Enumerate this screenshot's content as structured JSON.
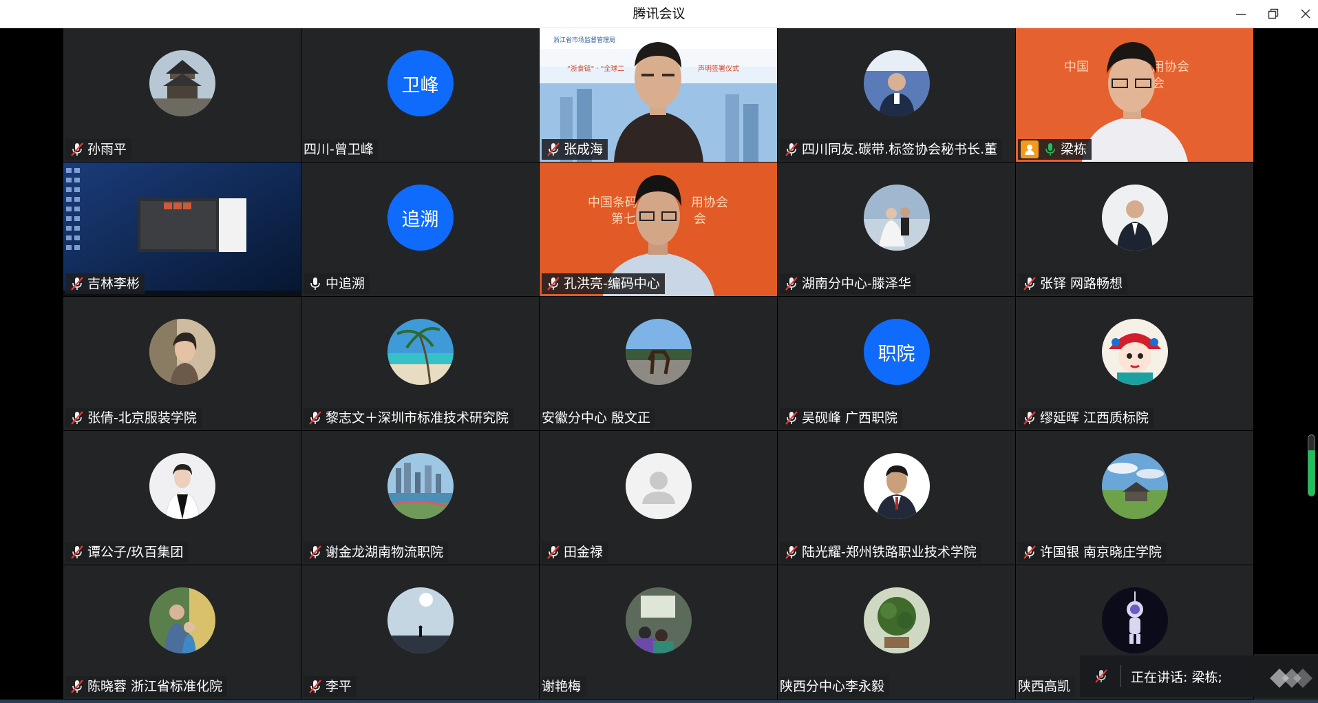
{
  "window": {
    "title": "腾讯会议"
  },
  "colors": {
    "accent": "#0e6bfb",
    "muted_mic": "#e43b3b",
    "active_mic": "#19c35a",
    "host_badge": "#f39a1c"
  },
  "participants": [
    {
      "name": "孙雨平",
      "mic": "muted",
      "avatar": "temple-photo"
    },
    {
      "name": "四川-曾卫峰",
      "mic": "none",
      "avatar_text": "卫峰"
    },
    {
      "name": "张成海",
      "mic": "muted",
      "video": "speaker-blue-banner"
    },
    {
      "name": "四川同友.碳带.标签协会秘书长.董",
      "mic": "muted",
      "avatar": "badge-photo"
    },
    {
      "name": "梁栋",
      "mic": "active",
      "host": true,
      "video": "speaker-orange-banner"
    },
    {
      "name": "吉林李彬",
      "mic": "muted",
      "video": "screen-share"
    },
    {
      "name": "中追溯",
      "mic": "on",
      "avatar_text": "追溯"
    },
    {
      "name": "孔洪亮-编码中心",
      "mic": "muted",
      "video": "speaker-orange-banner-2"
    },
    {
      "name": "湖南分中心-滕泽华",
      "mic": "muted",
      "avatar": "wedding-photo"
    },
    {
      "name": "张铎 网路畅想",
      "mic": "muted",
      "avatar": "suit-photo"
    },
    {
      "name": "张倩-北京服装学院",
      "mic": "muted",
      "avatar": "woman-photo"
    },
    {
      "name": "黎志文＋深圳市标准技术研究院",
      "mic": "muted",
      "avatar": "beach-photo"
    },
    {
      "name": "安徽分中心 殷文正",
      "mic": "none",
      "avatar": "horse-photo"
    },
    {
      "name": "吴砚峰 广西职院",
      "mic": "muted",
      "avatar_text": "职院"
    },
    {
      "name": "缪延晖  江西质标院",
      "mic": "muted",
      "avatar": "opera-photo"
    },
    {
      "name": "谭公子/玖百集团",
      "mic": "muted",
      "avatar": "lady-photo"
    },
    {
      "name": "谢金龙湖南物流职院",
      "mic": "muted",
      "avatar": "city-photo"
    },
    {
      "name": "田金禄",
      "mic": "muted",
      "avatar": "default-avatar"
    },
    {
      "name": "陆光耀-郑州铁路职业技术学院",
      "mic": "muted",
      "avatar": "man-photo"
    },
    {
      "name": "许国银 南京晓庄学院",
      "mic": "muted",
      "avatar": "house-photo"
    },
    {
      "name": "陈晓蓉 浙江省标准化院",
      "mic": "muted",
      "avatar": "mother-child-photo"
    },
    {
      "name": "李平",
      "mic": "muted",
      "avatar": "sky-photo"
    },
    {
      "name": "谢艳梅",
      "mic": "none",
      "avatar": "meeting-photo"
    },
    {
      "name": "陕西分中心李永毅",
      "mic": "none",
      "avatar": "tree-photo"
    },
    {
      "name": "陕西高凯",
      "mic": "none",
      "avatar": "astronaut-photo"
    }
  ],
  "speaking": {
    "text": "正在讲话: 梁栋;"
  },
  "mic_level": 0.75
}
